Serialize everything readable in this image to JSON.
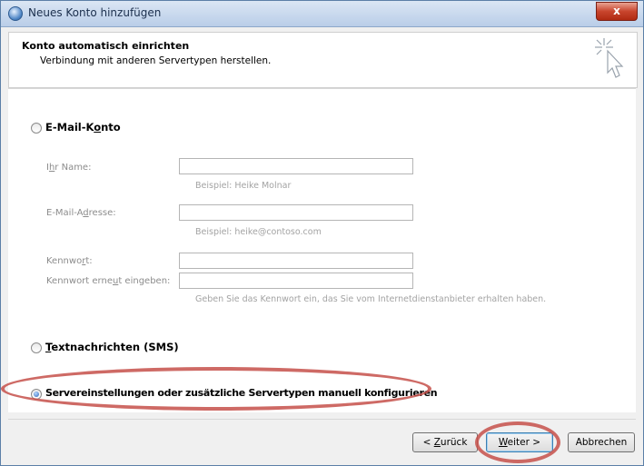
{
  "window": {
    "title": "Neues Konto hinzufügen",
    "close_label": "x"
  },
  "header": {
    "title": "Konto automatisch einrichten",
    "subtitle": "Verbindung mit anderen Servertypen herstellen."
  },
  "options": {
    "email": {
      "label_pre": "E-Mail-K",
      "label_u": "o",
      "label_post": "nto",
      "selected": false
    },
    "sms": {
      "label_u": "T",
      "label_post": "extnachrichten (SMS)",
      "selected": false
    },
    "manual": {
      "label": "Servereinstellungen oder zusätzliche Servertypen manuell konfigurieren",
      "selected": true
    }
  },
  "fields": {
    "name": {
      "label_pre": "I",
      "label_u": "h",
      "label_post": "r Name:",
      "value": "",
      "hint": "Beispiel: Heike Molnar"
    },
    "email": {
      "label_pre": "E-Mail-A",
      "label_u": "d",
      "label_post": "resse:",
      "value": "",
      "hint": "Beispiel: heike@contoso.com"
    },
    "password": {
      "label_pre": "Kennwo",
      "label_u": "r",
      "label_post": "t:",
      "value": ""
    },
    "password_repeat": {
      "label_pre": "Kennwort erne",
      "label_u": "u",
      "label_post": "t eingeben:",
      "value": ""
    },
    "password_hint": "Geben Sie das Kennwort ein, das Sie vom Internetdienstanbieter erhalten haben."
  },
  "buttons": {
    "back": {
      "pre": "< ",
      "u": "Z",
      "post": "urück"
    },
    "next": {
      "u": "W",
      "post": "eiter >"
    },
    "cancel": "Abbrechen"
  },
  "colors": {
    "annotation": "#c6504a",
    "titlebar": "#b9cde8",
    "close": "#c8452d"
  }
}
